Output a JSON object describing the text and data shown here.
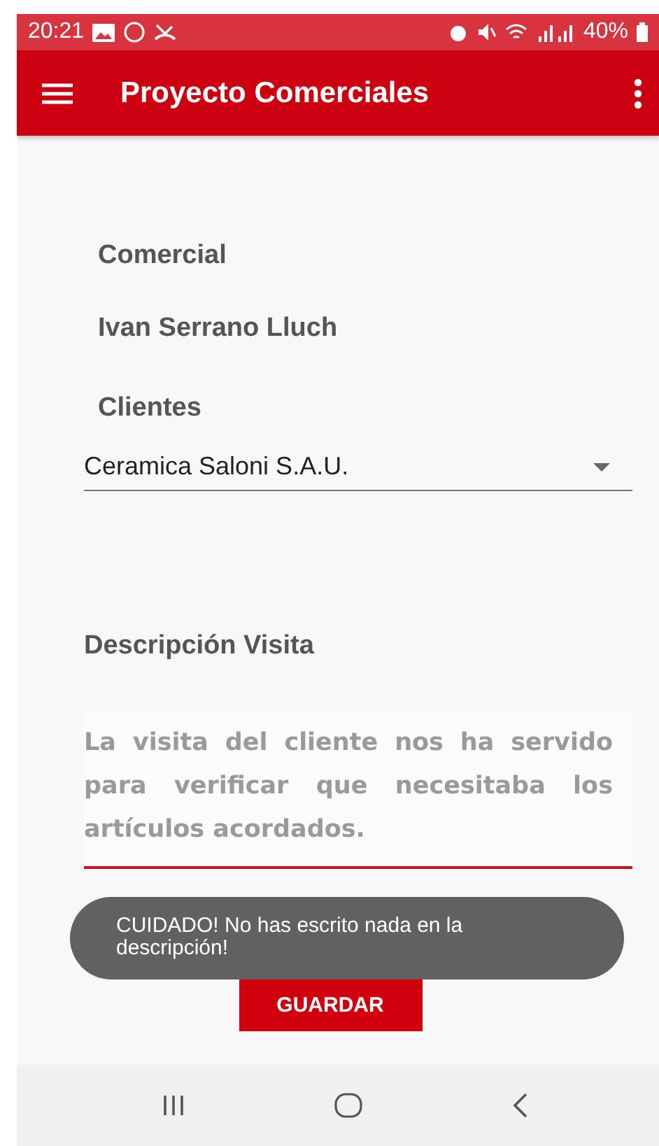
{
  "status_bar": {
    "time": "20:21",
    "battery": "40%"
  },
  "app_bar": {
    "title": "Proyecto Comerciales"
  },
  "form": {
    "comercial_label": "Comercial",
    "comercial_value": "Ivan Serrano Lluch",
    "clientes_label": "Clientes",
    "cliente_selected": "Ceramica Saloni S.A.U.",
    "descripcion_label": "Descripción Visita",
    "descripcion_value": "La visita del cliente nos ha servido para verificar que necesitaba los artículos acordados.",
    "save_button": "GUARDAR"
  },
  "toast": {
    "message": "CUIDADO! No has escrito nada en la descripción!"
  }
}
